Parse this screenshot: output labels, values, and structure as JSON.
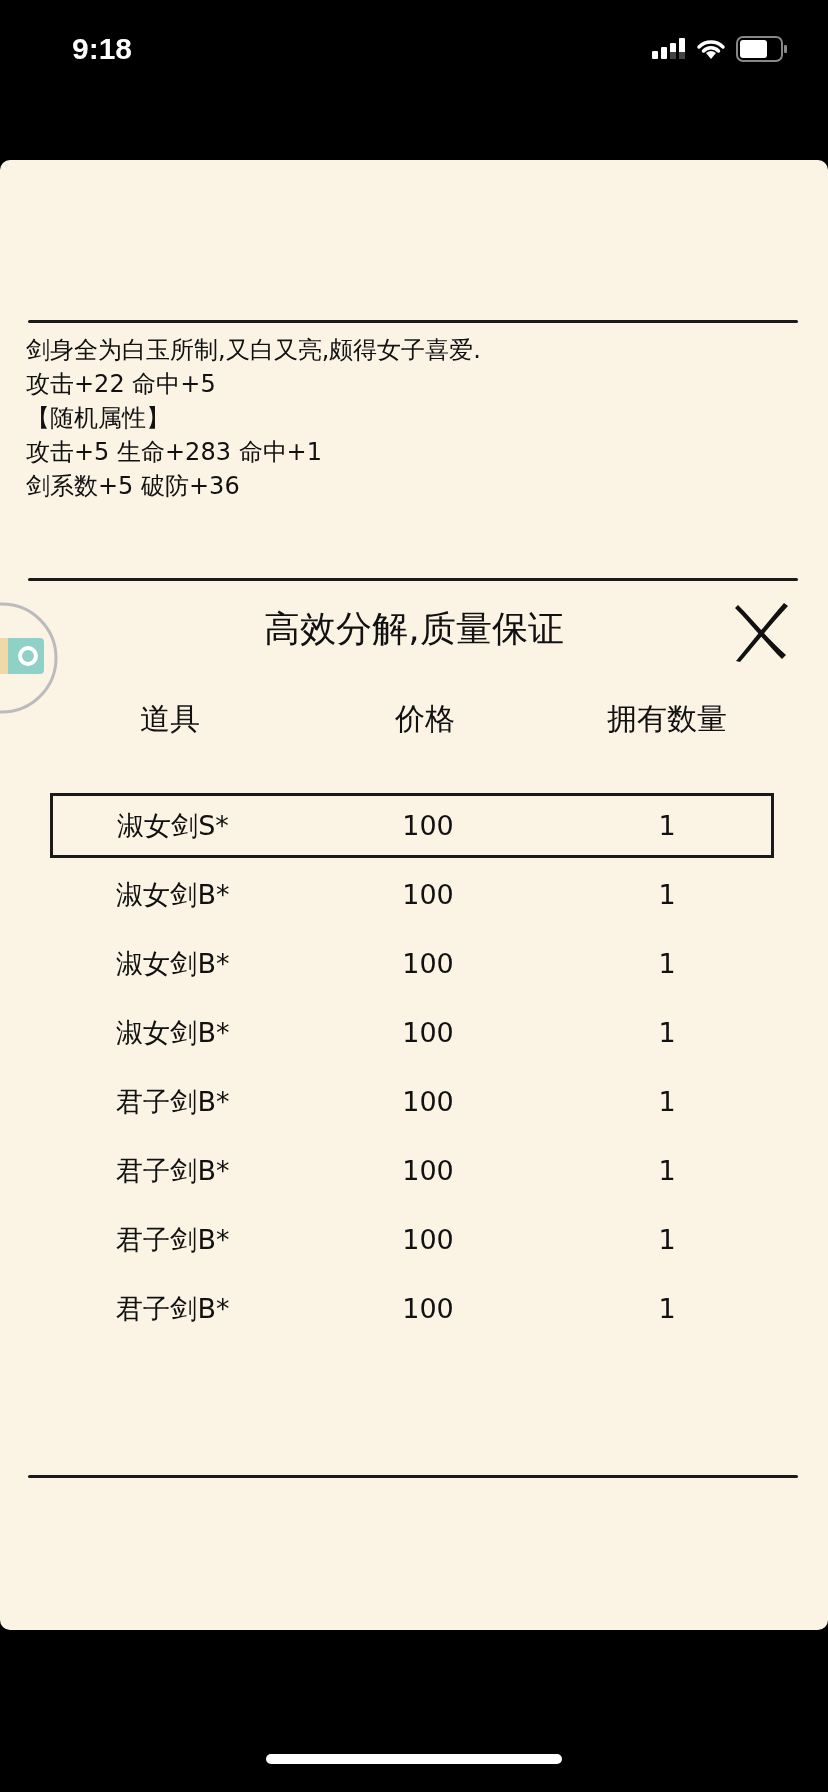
{
  "status_bar": {
    "time": "9:18"
  },
  "description": {
    "lines": [
      "剑身全为白玉所制,又白又亮,颇得女子喜爱.",
      "攻击+22 命中+5",
      "【随机属性】",
      "攻击+5 生命+283 命中+1",
      "剑系数+5 破防+36"
    ]
  },
  "dialog": {
    "title": "高效分解,质量保证",
    "table": {
      "columns": [
        "道具",
        "价格",
        "拥有数量"
      ],
      "rows": [
        {
          "item": "淑女剑S*",
          "price": "100",
          "count": "1",
          "selected": true
        },
        {
          "item": "淑女剑B*",
          "price": "100",
          "count": "1",
          "selected": false
        },
        {
          "item": "淑女剑B*",
          "price": "100",
          "count": "1",
          "selected": false
        },
        {
          "item": "淑女剑B*",
          "price": "100",
          "count": "1",
          "selected": false
        },
        {
          "item": "君子剑B*",
          "price": "100",
          "count": "1",
          "selected": false
        },
        {
          "item": "君子剑B*",
          "price": "100",
          "count": "1",
          "selected": false
        },
        {
          "item": "君子剑B*",
          "price": "100",
          "count": "1",
          "selected": false
        },
        {
          "item": "君子剑B*",
          "price": "100",
          "count": "1",
          "selected": false
        }
      ]
    }
  }
}
